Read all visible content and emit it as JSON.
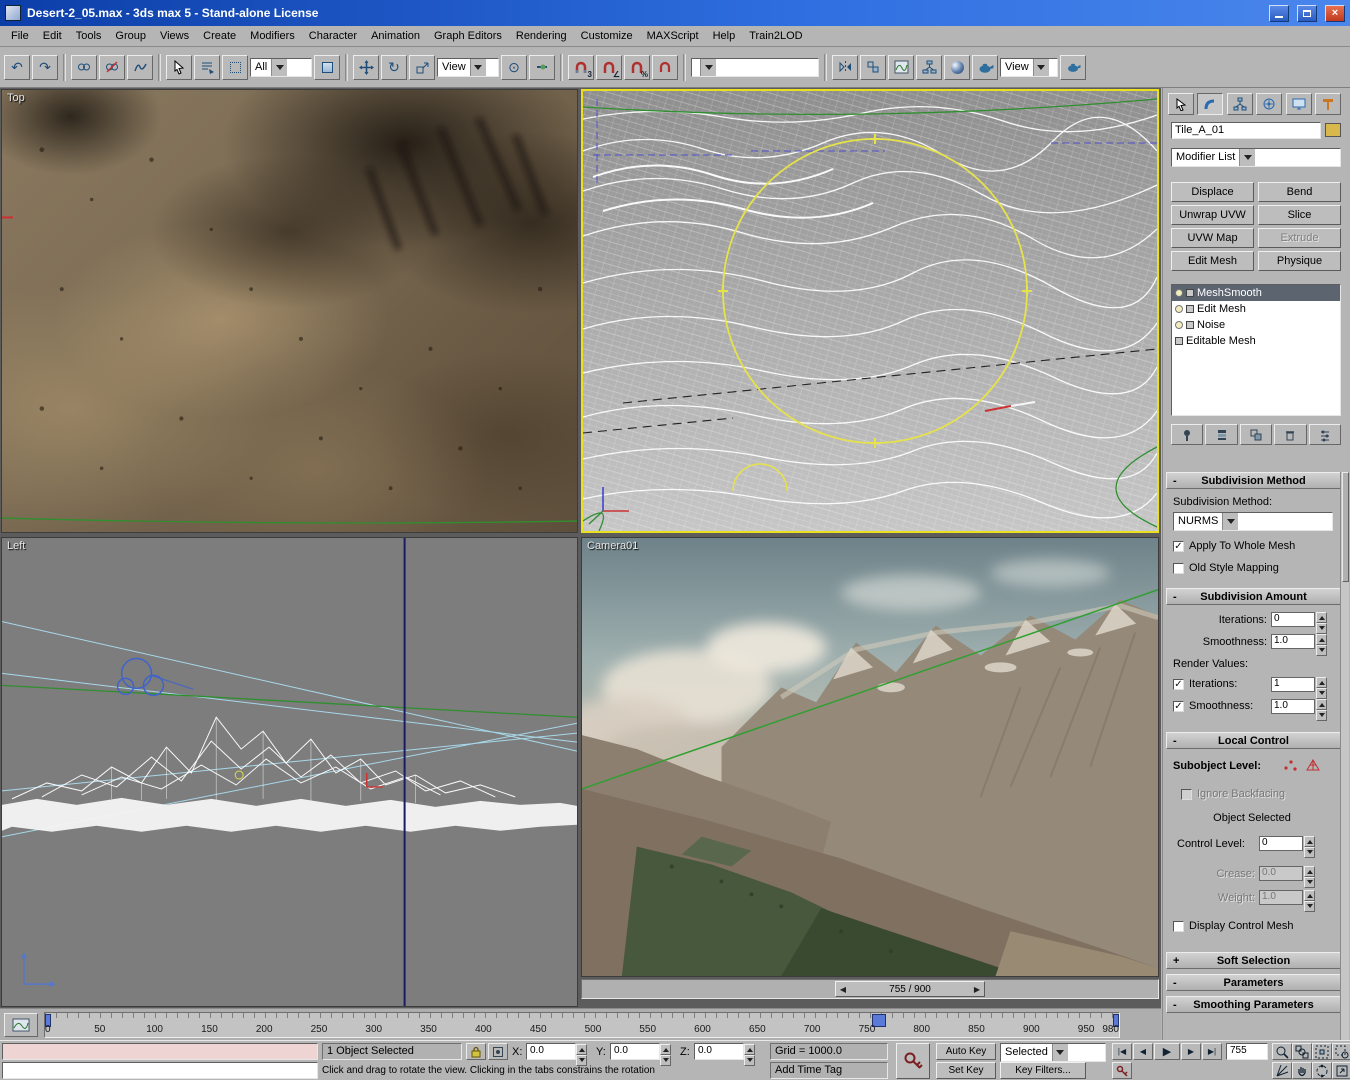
{
  "window": {
    "title": "Desert-2_05.max - 3ds max 5 - Stand-alone License"
  },
  "menu": {
    "items": [
      "File",
      "Edit",
      "Tools",
      "Group",
      "Views",
      "Create",
      "Modifiers",
      "Character",
      "Animation",
      "Graph Editors",
      "Rendering",
      "Customize",
      "MAXScript",
      "Help",
      "Train2LOD"
    ]
  },
  "toolbar": {
    "selection_filter": "All",
    "coord_system": "View",
    "named_selection": "",
    "render_type": "View"
  },
  "icons": {
    "undo": "↶",
    "redo": "↷",
    "rotate": "↻",
    "use_center": "⊙",
    "angle": "∠",
    "percent": "%",
    "snap3": "3",
    "check": "✓",
    "close": "×",
    "expanded": "-",
    "collapsed": "+",
    "play": "▶",
    "prev": "◀",
    "next": "▶",
    "go_start": "|◀",
    "go_end": "▶|",
    "slider_left": "◀",
    "slider_right": "▶"
  },
  "viewports": {
    "top": "Top",
    "left": "Left",
    "camera": "Camera01"
  },
  "time_slider": {
    "value": "755 / 900"
  },
  "trackbar": {
    "ticks": [
      "0",
      "50",
      "100",
      "150",
      "200",
      "250",
      "300",
      "350",
      "400",
      "450",
      "500",
      "550",
      "600",
      "650",
      "700",
      "750",
      "800",
      "850",
      "900",
      "950",
      "980"
    ]
  },
  "panel": {
    "object_name": "Tile_A_01",
    "modifier_list": "Modifier List",
    "btn_displace": "Displace",
    "btn_bend": "Bend",
    "btn_unwrap": "Unwrap UVW",
    "btn_slice": "Slice",
    "btn_uvwmap": "UVW Map",
    "btn_extrude": "Extrude",
    "btn_editmesh": "Edit Mesh",
    "btn_physique": "Physique",
    "stack": [
      "MeshSmooth",
      "Edit Mesh",
      "Noise",
      "Editable Mesh"
    ],
    "ro_subdiv_method": "Subdivision Method",
    "subdiv_method_label": "Subdivision Method:",
    "subdiv_method_value": "NURMS",
    "cb_apply_whole": "Apply To Whole Mesh",
    "cb_old_style": "Old Style Mapping",
    "ro_subdiv_amount": "Subdivision Amount",
    "iterations_label": "Iterations:",
    "iterations_value": "0",
    "smoothness_label": "Smoothness:",
    "smoothness_value": "1.0",
    "render_values_label": "Render Values:",
    "render_iterations_value": "1",
    "render_smoothness_value": "1.0",
    "ro_local_control": "Local Control",
    "subobject_label": "Subobject Level:",
    "cb_ignore_backfacing": "Ignore Backfacing",
    "object_selected": "Object Selected",
    "control_level_label": "Control Level:",
    "control_level_value": "0",
    "crease_label": "Crease:",
    "crease_value": "0.0",
    "weight_label": "Weight:",
    "weight_value": "1.0",
    "cb_display_control_mesh": "Display Control Mesh",
    "ro_soft_selection": "Soft Selection",
    "ro_parameters": "Parameters",
    "ro_smoothing": "Smoothing Parameters"
  },
  "status": {
    "selection": "1 Object Selected",
    "x_label": "X:",
    "y_label": "Y:",
    "z_label": "Z:",
    "x": "0.0",
    "y": "0.0",
    "z": "0.0",
    "grid": "Grid = 1000.0",
    "prompt": "Click and drag to rotate the view. Clicking in the tabs constrains the rotation",
    "add_time_tag": "Add Time Tag",
    "auto_key": "Auto Key",
    "set_key": "Set Key",
    "selected_mode": "Selected",
    "key_filters": "Key Filters...",
    "frame": "755"
  }
}
